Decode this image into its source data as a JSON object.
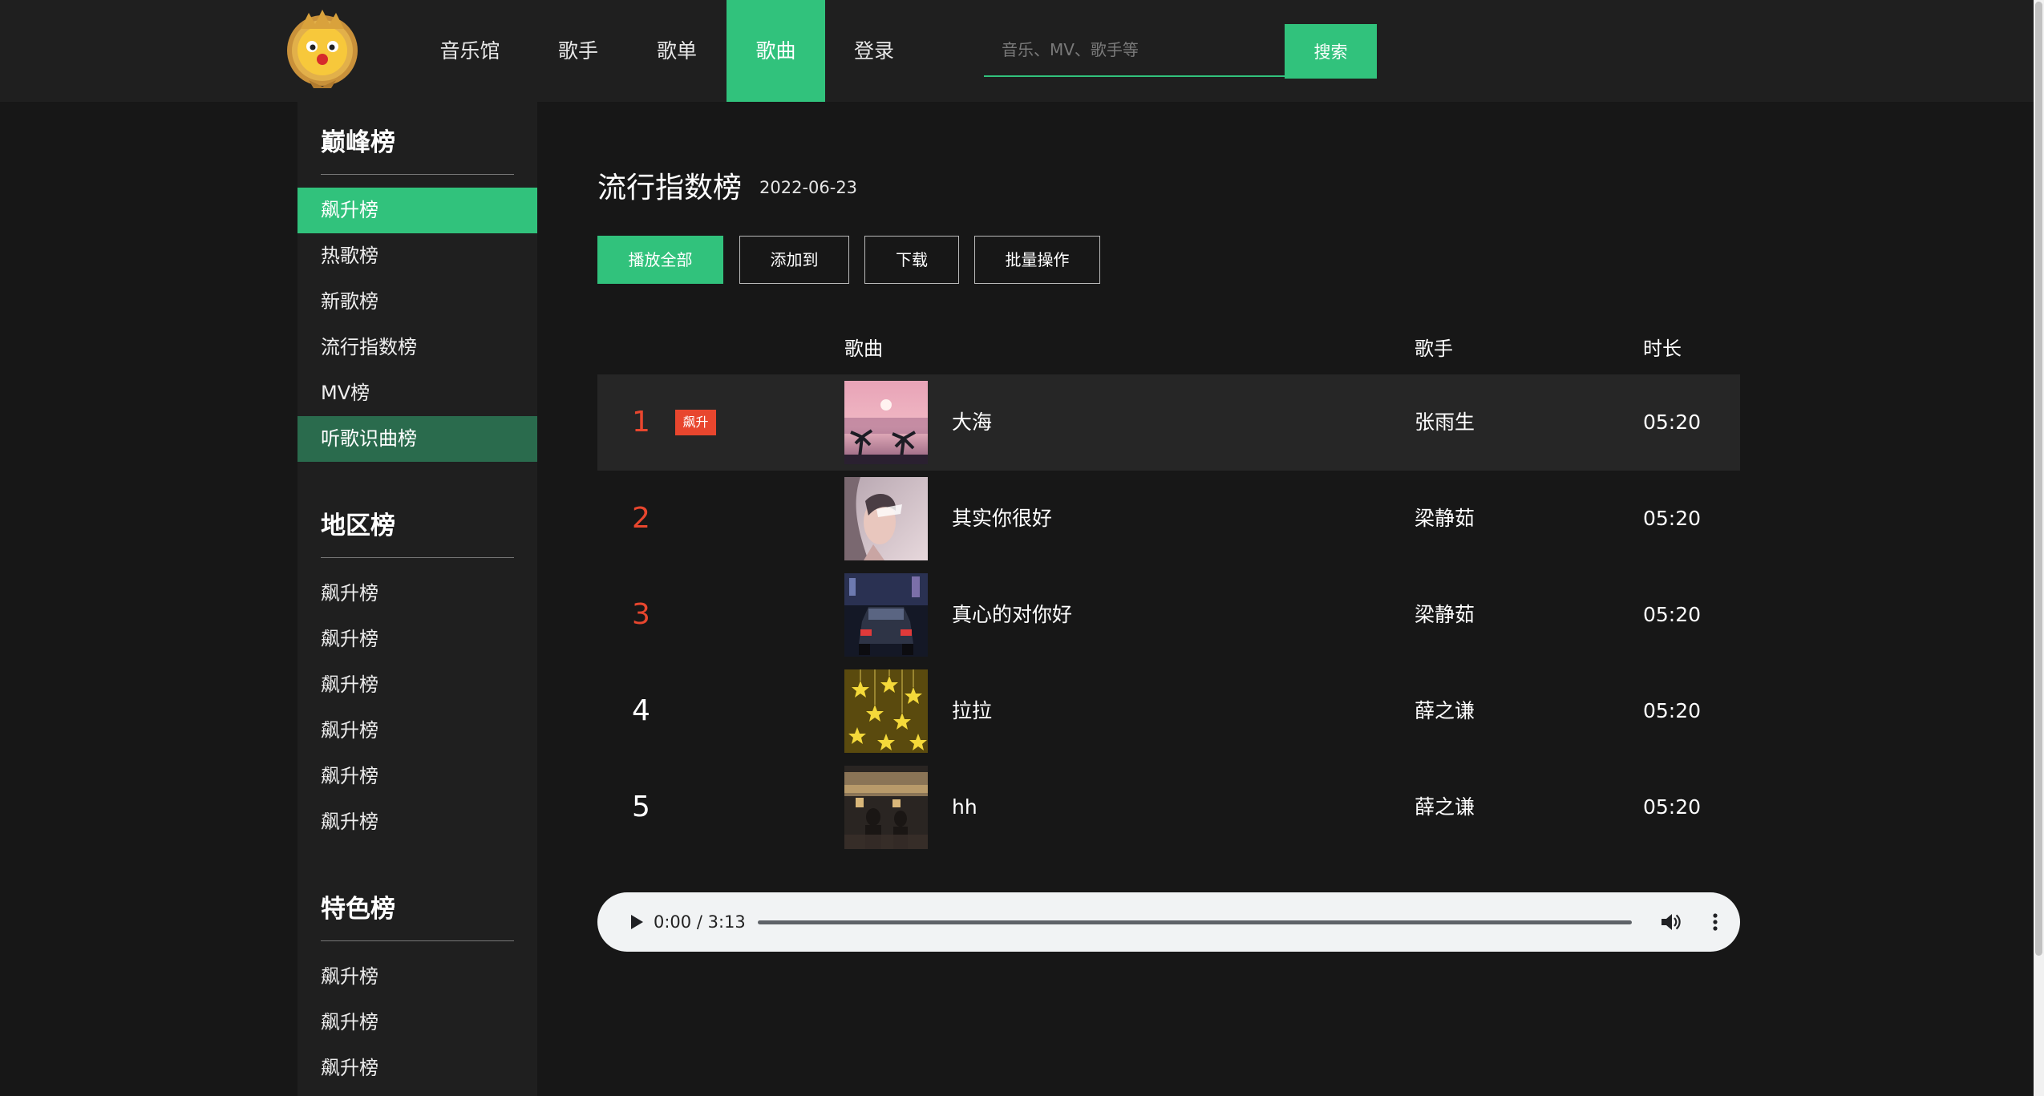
{
  "nav": {
    "items": [
      {
        "label": "音乐馆"
      },
      {
        "label": "歌手"
      },
      {
        "label": "歌单"
      },
      {
        "label": "歌曲"
      },
      {
        "label": "登录"
      }
    ],
    "active": "歌曲",
    "search_placeholder": "音乐、MV、歌手等",
    "search_button": "搜索"
  },
  "sidebar": {
    "groups": [
      {
        "heading": "巅峰榜",
        "items": [
          "飙升榜",
          "热歌榜",
          "新歌榜",
          "流行指数榜",
          "MV榜",
          "听歌识曲榜"
        ]
      },
      {
        "heading": "地区榜",
        "items": [
          "飙升榜",
          "飙升榜",
          "飙升榜",
          "飙升榜",
          "飙升榜",
          "飙升榜"
        ]
      },
      {
        "heading": "特色榜",
        "items": [
          "飙升榜",
          "飙升榜",
          "飙升榜"
        ]
      }
    ],
    "active_item": "飙升榜",
    "hover_item": "听歌识曲榜"
  },
  "main": {
    "title": "流行指数榜",
    "date": "2022-06-23",
    "buttons": {
      "play_all": "播放全部",
      "add_to": "添加到",
      "download": "下载",
      "batch": "批量操作"
    },
    "columns": {
      "song": "歌曲",
      "singer": "歌手",
      "duration": "时长"
    },
    "rows": [
      {
        "rank": "1",
        "badge": "飙升",
        "song": "大海",
        "singer": "张雨生",
        "duration": "05:20",
        "cover": "sunset-palm"
      },
      {
        "rank": "2",
        "badge": "",
        "song": "其实你很好",
        "singer": "梁静茹",
        "duration": "05:20",
        "cover": "portrait"
      },
      {
        "rank": "3",
        "badge": "",
        "song": "真心的对你好",
        "singer": "梁静茹",
        "duration": "05:20",
        "cover": "night-car"
      },
      {
        "rank": "4",
        "badge": "",
        "song": "拉拉",
        "singer": "薛之谦",
        "duration": "05:20",
        "cover": "stars"
      },
      {
        "rank": "5",
        "badge": "",
        "song": "hh",
        "singer": "薛之谦",
        "duration": "05:20",
        "cover": "cafe"
      }
    ]
  },
  "player": {
    "time": "0:00 / 3:13",
    "progress": 0
  },
  "colors": {
    "accent": "#31c27c",
    "rank_red": "#e8462e"
  }
}
